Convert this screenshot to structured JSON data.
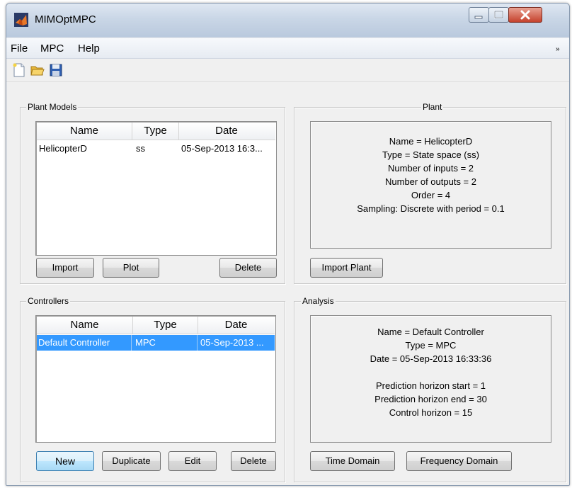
{
  "window": {
    "title": "MIMOptMPC"
  },
  "menu": {
    "file": "File",
    "mpc": "MPC",
    "help": "Help",
    "overflow": "»"
  },
  "toolbar": {
    "new_icon": "new-file-icon",
    "open_icon": "open-folder-icon",
    "save_icon": "save-disk-icon"
  },
  "plant_models": {
    "title": "Plant Models",
    "columns": [
      "Name",
      "Type",
      "Date"
    ],
    "rows": [
      {
        "name": "HelicopterD",
        "type": "ss",
        "date": "05-Sep-2013 16:3..."
      }
    ],
    "buttons": {
      "import": "Import",
      "plot": "Plot",
      "delete": "Delete"
    }
  },
  "plant": {
    "title": "Plant",
    "lines": [
      "Name = HelicopterD",
      "Type = State space (ss)",
      "Number of inputs = 2",
      "Number of outputs = 2",
      "Order = 4",
      "Sampling:  Discrete with period = 0.1"
    ],
    "import_button": "Import Plant"
  },
  "controllers": {
    "title": "Controllers",
    "columns": [
      "Name",
      "Type",
      "Date"
    ],
    "rows": [
      {
        "name": "Default Controller",
        "type": "MPC",
        "date": "05-Sep-2013 ..."
      }
    ],
    "buttons": {
      "new": "New",
      "duplicate": "Duplicate",
      "edit": "Edit",
      "delete": "Delete"
    }
  },
  "analysis": {
    "title": "Analysis",
    "lines": [
      "Name = Default Controller",
      "Type = MPC",
      "Date = 05-Sep-2013 16:33:36",
      "",
      "Prediction horizon start = 1",
      "Prediction horizon end = 30",
      "Control horizon = 15"
    ],
    "buttons": {
      "time_domain": "Time Domain",
      "frequency_domain": "Frequency Domain"
    }
  },
  "colors": {
    "selection": "#3399ff",
    "window_bg": "#f0f0f0",
    "close_button": "#c5412c"
  }
}
